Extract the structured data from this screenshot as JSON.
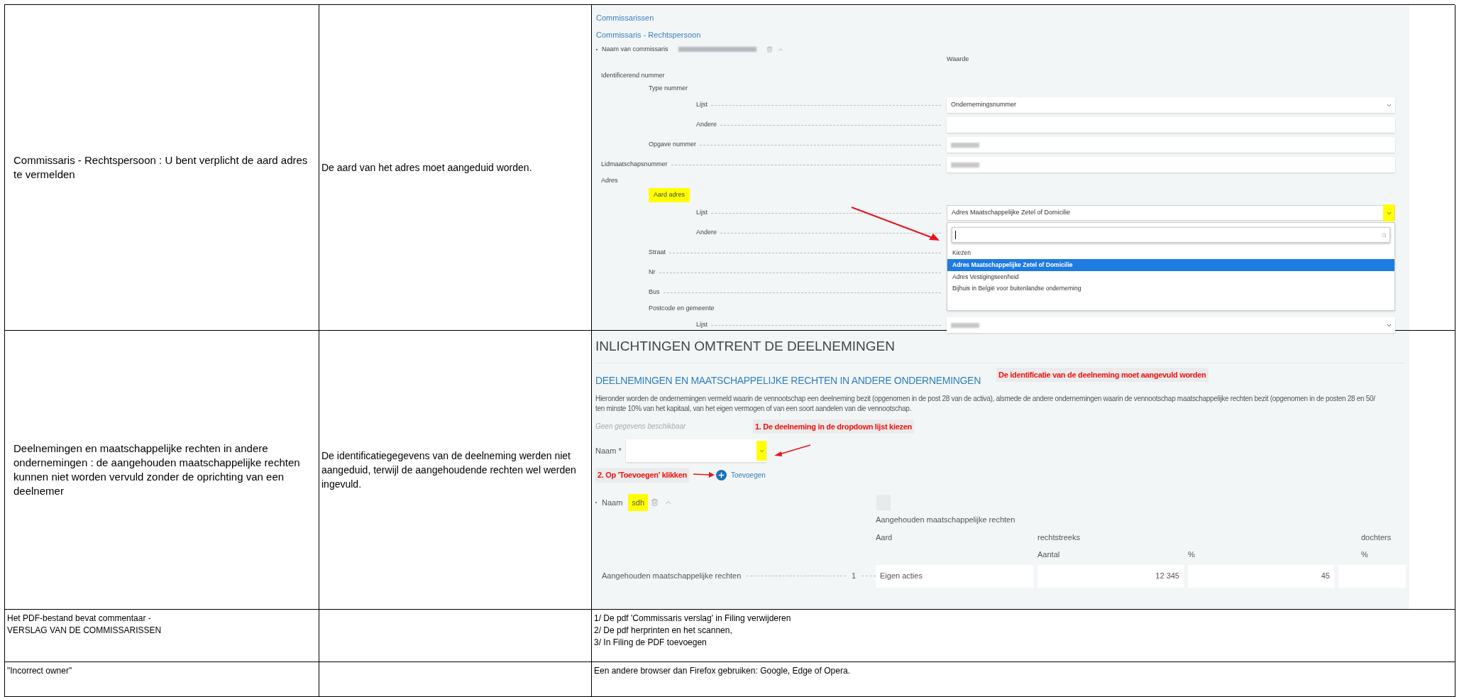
{
  "table": {
    "rows": [
      {
        "kind": "commissaris_form",
        "error": "Commissaris - Rechtspersoon : U bent verplicht de aard adres te vermelden",
        "explanation": "De aard van het adres moet aangeduid worden.",
        "screenshot": {
          "section_title": "Commissarissen",
          "subsection_title": "Commissaris - Rechtspersoon",
          "name_label": "Naam van commissaris",
          "value_header": "Waarde",
          "fields": [
            {
              "label": "Identificerend nummer",
              "leader": false,
              "highlighted": false,
              "children": [
                {
                  "label": "Type nummer",
                  "leader": false,
                  "highlighted": false,
                  "children": [
                    {
                      "label": "Lijst",
                      "leader": true,
                      "highlighted": false,
                      "field": {
                        "kind": "select",
                        "value": "Ondernemingsnummer",
                        "caret_highlighted": false,
                        "open": false
                      }
                    },
                    {
                      "label": "Andere",
                      "leader": true,
                      "highlighted": false,
                      "field": {
                        "kind": "input"
                      }
                    }
                  ]
                },
                {
                  "label": "Opgave nummer",
                  "leader": true,
                  "highlighted": false,
                  "field": {
                    "kind": "redacted"
                  }
                }
              ]
            },
            {
              "label": "Lidmaatschapsnummer",
              "leader": true,
              "highlighted": false,
              "field": {
                "kind": "redacted"
              }
            },
            {
              "label": "Adres",
              "leader": false,
              "highlighted": false,
              "children": [
                {
                  "label": "Aard adres",
                  "leader": false,
                  "highlighted": true,
                  "children": [
                    {
                      "label": "Lijst",
                      "leader": true,
                      "highlighted": false,
                      "field": {
                        "kind": "select",
                        "value": "Adres Maatschappelijke Zetel of Domicilie",
                        "caret_highlighted": true,
                        "open": true,
                        "options": [
                          {
                            "label": "Kiezen",
                            "selected": false
                          },
                          {
                            "label": "Adres Maatschappelijke Zetel of Domicilie",
                            "selected": true
                          },
                          {
                            "label": "Adres Vestigingseenheid",
                            "selected": false
                          },
                          {
                            "label": "Bijhuis in België voor buitenlandse onderneming",
                            "selected": false
                          }
                        ]
                      }
                    },
                    {
                      "label": "Andere",
                      "leader": true,
                      "highlighted": false
                    }
                  ]
                },
                {
                  "label": "Straat",
                  "leader": true,
                  "highlighted": false
                },
                {
                  "label": "Nr",
                  "leader": true,
                  "highlighted": false
                },
                {
                  "label": "Bus",
                  "leader": true,
                  "highlighted": false
                },
                {
                  "label": "Postcode en gemeente",
                  "leader": false,
                  "highlighted": false,
                  "children": [
                    {
                      "label": "Lijst",
                      "leader": true,
                      "highlighted": false,
                      "field": {
                        "kind": "redacted_select",
                        "caret_highlighted": false,
                        "open": false
                      }
                    }
                  ]
                }
              ]
            }
          ]
        }
      },
      {
        "kind": "deelneming_form",
        "error": "Deelnemingen en maatschappelijke rechten in andere ondernemingen : de aangehouden maatschappelijke rechten kunnen niet worden vervuld zonder de oprichting van een deelnemer",
        "explanation": "De identificatiegegevens van de deelneming werden niet aangeduid, terwijl de aangehoudende rechten wel werden ingevuld.",
        "screenshot": {
          "page_title": "INLICHTINGEN OMTRENT DE DEELNEMINGEN",
          "section_title": "DEELNEMINGEN EN MAATSCHAPPELIJKE RECHTEN IN ANDERE ONDERNEMINGEN",
          "note_identification": "De identificatie van de deelneming moet aangevuld worden",
          "description_lines": [
            "Hieronder worden de ondernemingen vermeld waarin de vennootschap een deelneming bezit (opgenomen in de post 28 van de activa), alsmede de andere ondernemingen waarin de vennootschap maatschappelijke rechten bezit (opgenomen in de posten 28 en 50/",
            "ten minste 10% van het kapitaal, van het eigen vermogen of van een soort aandelen van die vennootschap."
          ],
          "empty_text": "Geen gegevens beschikbaar",
          "note_step1": "1. De deelneming in de dropdown lijst kiezen",
          "name_field": {
            "label": "Naam *",
            "caret_highlighted": true
          },
          "note_step2": "2. Op 'Toevoegen' klikken",
          "add_link": "Toevoegen",
          "entry": {
            "name_label": "Naam",
            "name_value": "sdh",
            "name_highlighted": true
          },
          "rights_table": {
            "title": "Aangehouden maatschappelijke rechten",
            "col_aard": "Aard",
            "col_direct": "rechtstreeks",
            "col_subsidiaries": "dochters",
            "sub_aantal": "Aantal",
            "sub_pct_direct": "%",
            "sub_pct_subsidiaries": "%",
            "row": {
              "label": "Aangehouden maatschappelijke rechten",
              "number": "1",
              "aard": "Eigen acties",
              "aantal": "12 345",
              "pct_direct": "45"
            }
          }
        }
      },
      {
        "kind": "text",
        "error_lines": [
          "Het PDF-bestand bevat commentaar -",
          "VERSLAG VAN DE COMMISSARISSEN"
        ],
        "solution_lines": [
          "1/ De pdf 'Commissaris verslag' in Filing verwijderen",
          "2/ De pdf herprinten en het scannen,",
          "3/ In Filing de PDF toevoegen"
        ]
      },
      {
        "kind": "text",
        "error_lines": [
          "\"Incorrect owner\""
        ],
        "solution_lines": [
          "Een andere browser dan Firefox gebruiken: Google, Edge of Opera."
        ]
      }
    ]
  }
}
